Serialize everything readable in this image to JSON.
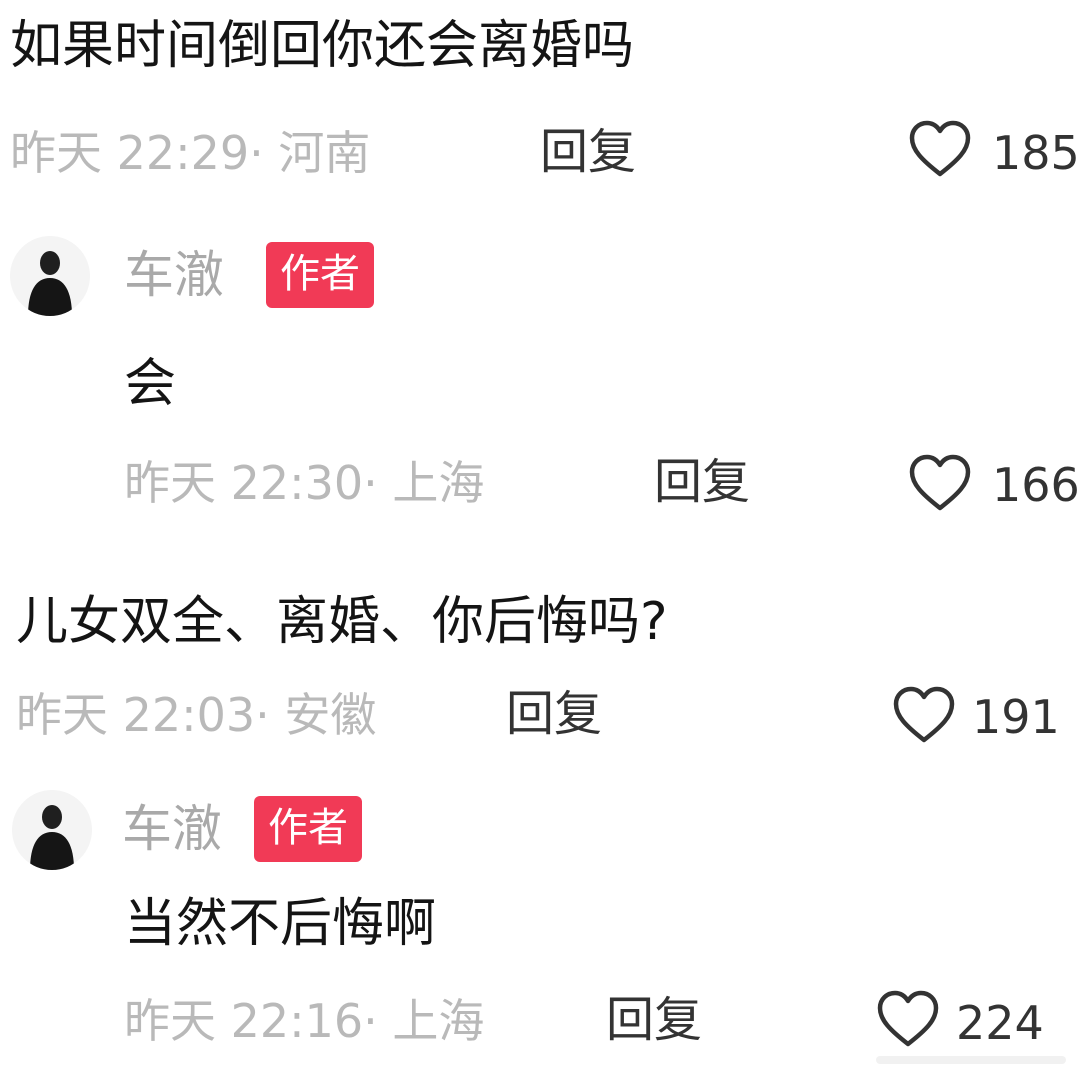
{
  "comments": [
    {
      "text": "如果时间倒回你还会离婚吗",
      "meta": "昨天 22:29· 河南",
      "reply_label": "回复",
      "likes": "185"
    },
    {
      "author": "车澈",
      "badge": "作者",
      "text": "会",
      "meta": "昨天 22:30· 上海",
      "reply_label": "回复",
      "likes": "166"
    },
    {
      "text": "儿女双全、离婚、你后悔吗?",
      "meta": "昨天 22:03· 安徽",
      "reply_label": "回复",
      "likes": "191"
    },
    {
      "author": "车澈",
      "badge": "作者",
      "text": "当然不后悔啊",
      "meta": "昨天 22:16· 上海",
      "reply_label": "回复",
      "likes": "224"
    }
  ],
  "icons": {
    "like": "heart-outline-icon",
    "avatar": "author-avatar"
  },
  "colors": {
    "badge_bg": "#f13a56",
    "meta_text": "#b9b9b9",
    "author_name": "#a9a9a9"
  }
}
